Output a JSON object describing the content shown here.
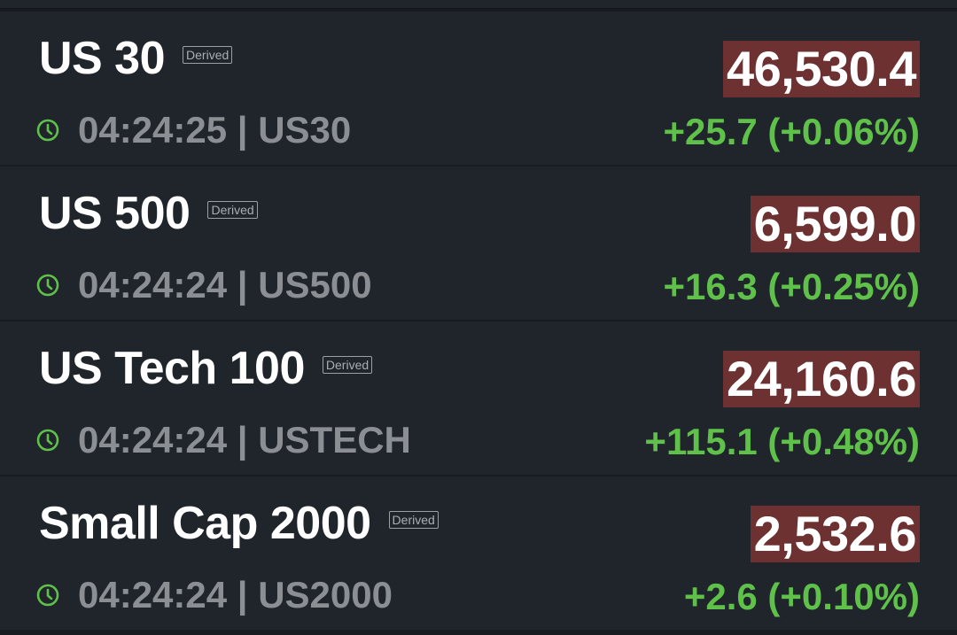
{
  "badge_label": "Derived",
  "colors": {
    "background": "#1f252b",
    "divider": "#15181c",
    "price_bg": "#6e3131",
    "change_positive": "#5fc04a",
    "muted_text": "#8b8f94"
  },
  "instruments": [
    {
      "name": "US 30",
      "badge": "Derived",
      "time": "04:24:25",
      "symbol": "US30",
      "time_line": "04:24:25 | US30",
      "price": "46,530.4",
      "change": "+25.7 (+0.06%)"
    },
    {
      "name": "US 500",
      "badge": "Derived",
      "time": "04:24:24",
      "symbol": "US500",
      "time_line": "04:24:24 | US500",
      "price": "6,599.0",
      "change": "+16.3 (+0.25%)"
    },
    {
      "name": "US Tech 100",
      "badge": "Derived",
      "time": "04:24:24",
      "symbol": "USTECH",
      "time_line": "04:24:24 | USTECH",
      "price": "24,160.6",
      "change": "+115.1 (+0.48%)"
    },
    {
      "name": "Small Cap 2000",
      "badge": "Derived",
      "time": "04:24:24",
      "symbol": "US2000",
      "time_line": "04:24:24 | US2000",
      "price": "2,532.6",
      "change": "+2.6 (+0.10%)"
    }
  ]
}
